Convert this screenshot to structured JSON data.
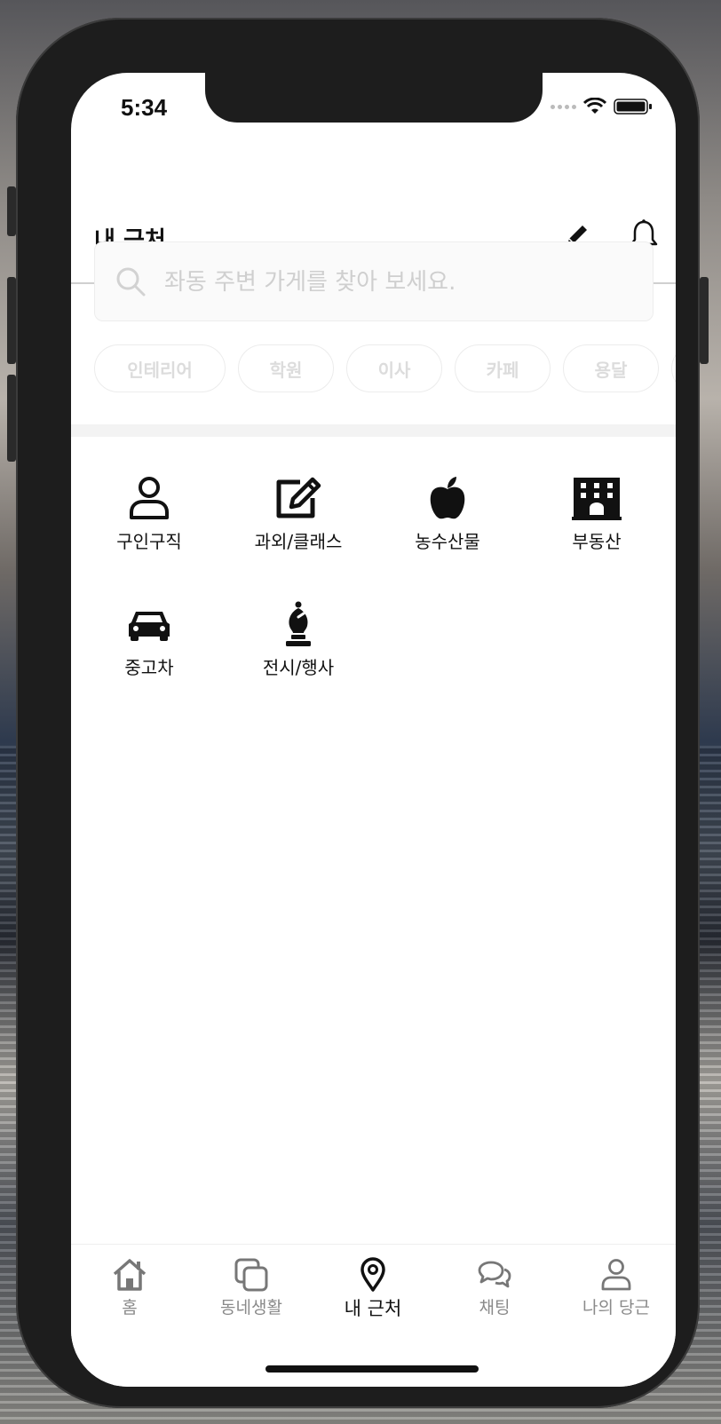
{
  "status": {
    "time": "5:34"
  },
  "header": {
    "title": "내 근처",
    "edit_icon": "pencil-icon",
    "bell_icon": "bell-icon"
  },
  "search": {
    "placeholder": "좌동 주변 가게를 찾아 보세요.",
    "value": ""
  },
  "chips": [
    "인테리어",
    "학원",
    "이사",
    "카페",
    "용달"
  ],
  "categories": [
    {
      "label": "구인구직",
      "icon": "person-icon"
    },
    {
      "label": "과외/클래스",
      "icon": "edit-square-icon"
    },
    {
      "label": "농수산물",
      "icon": "apple-icon"
    },
    {
      "label": "부동산",
      "icon": "building-icon"
    },
    {
      "label": "중고차",
      "icon": "car-icon"
    },
    {
      "label": "전시/행사",
      "icon": "chess-bishop-icon"
    }
  ],
  "tabs": [
    {
      "label": "홈",
      "icon": "home-icon"
    },
    {
      "label": "동네생활",
      "icon": "copy-icon"
    },
    {
      "label": "내 근처",
      "icon": "location-pin-icon",
      "active": true
    },
    {
      "label": "채팅",
      "icon": "chat-bubbles-icon"
    },
    {
      "label": "나의 당근",
      "icon": "user-icon"
    }
  ]
}
